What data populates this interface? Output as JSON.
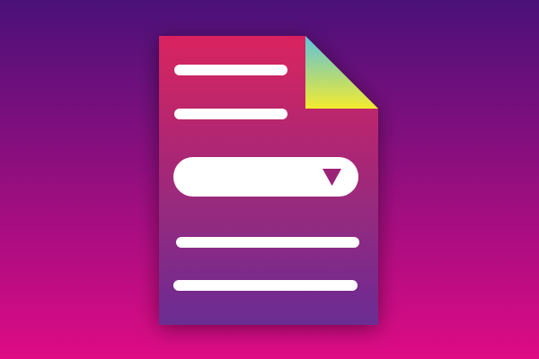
{
  "colors": {
    "background_top": "#4a1179",
    "background_bottom": "#de0b85",
    "document_top": "#d9245f",
    "document_bottom": "#6a2d93",
    "fold_top": "#5cc3de",
    "fold_bottom": "#f3eb2e",
    "line": "#ffffff",
    "dropdown_field": "#ffffff",
    "dropdown_arrow": "#9b2277"
  },
  "icons": {
    "document": "document-icon",
    "folded_corner": "folded-corner-icon",
    "dropdown_arrow": "triangle-down-icon"
  },
  "dropdown": {
    "selected_value": ""
  }
}
